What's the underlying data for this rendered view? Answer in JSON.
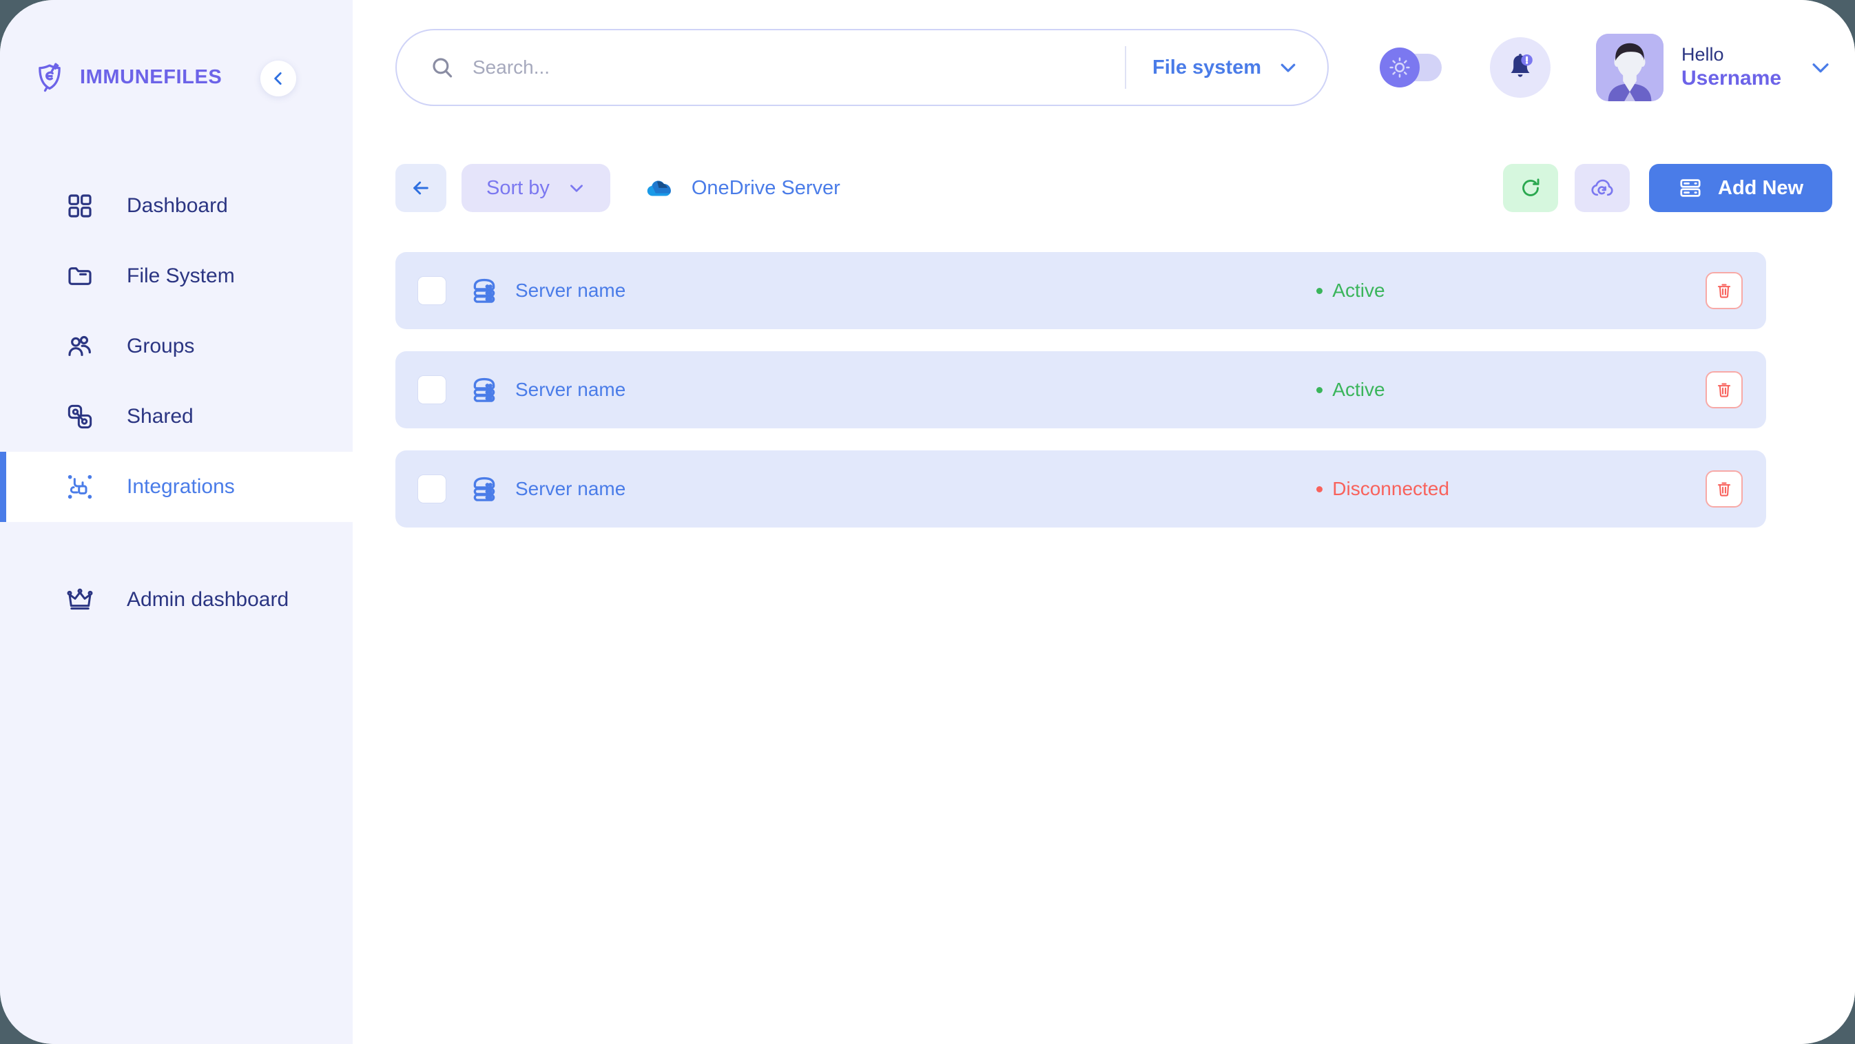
{
  "brand": {
    "name": "IMMUNEFILES",
    "logo_icon": "shield-immunity-icon",
    "collapse_icon": "chevron-left-icon"
  },
  "sidebar": {
    "items": [
      {
        "label": "Dashboard",
        "icon": "grid-squares-icon",
        "active": false
      },
      {
        "label": "File System",
        "icon": "folder-icon",
        "active": false
      },
      {
        "label": "Groups",
        "icon": "users-group-icon",
        "active": false
      },
      {
        "label": "Shared",
        "icon": "shared-link-icon",
        "active": false
      },
      {
        "label": "Integrations",
        "icon": "integrations-nodes-icon",
        "active": true
      },
      {
        "label": "Admin dashboard",
        "icon": "crown-icon",
        "active": false
      }
    ]
  },
  "header": {
    "search": {
      "placeholder": "Search...",
      "value": "",
      "icon": "search-icon"
    },
    "filter": {
      "label": "File system",
      "icon": "chevron-down-icon"
    },
    "theme_toggle": {
      "state": "light",
      "icon": "sun-icon"
    },
    "notifications": {
      "icon": "bell-icon",
      "badge": "!"
    },
    "user": {
      "greeting": "Hello",
      "name": "Username",
      "avatar_icon": "user-avatar",
      "chevron_icon": "chevron-down-icon"
    }
  },
  "toolbar": {
    "back_icon": "arrow-left-icon",
    "sort_by_label": "Sort by",
    "sort_by_chevron": "chevron-down-icon",
    "breadcrumb_label": "OneDrive Server",
    "breadcrumb_icon": "onedrive-cloud-icon",
    "refresh_icon": "refresh-icon",
    "cloud_sync_icon": "cloud-sync-icon",
    "add_new_label": "Add New",
    "add_new_icon": "server-rack-icon"
  },
  "list": {
    "rows": [
      {
        "name": "Server name",
        "status": "Active",
        "status_type": "active",
        "icon": "server-stack-icon",
        "checked": false,
        "delete_icon": "trash-icon"
      },
      {
        "name": "Server name",
        "status": "Active",
        "status_type": "active",
        "icon": "server-stack-icon",
        "checked": false,
        "delete_icon": "trash-icon"
      },
      {
        "name": "Server name",
        "status": "Disconnected",
        "status_type": "disconnected",
        "icon": "server-stack-icon",
        "checked": false,
        "delete_icon": "trash-icon"
      }
    ]
  },
  "colors": {
    "brand_purple": "#6c63e8",
    "accent_blue": "#4a7ce8",
    "nav_navy": "#2b3582",
    "status_active": "#3ab55b",
    "status_disconnected": "#f8625c",
    "row_bg": "#e2e8fb",
    "sidebar_bg": "#f2f3fd",
    "page_outer_bg": "#4c6069",
    "scrollbar": "#8b8bf7"
  }
}
